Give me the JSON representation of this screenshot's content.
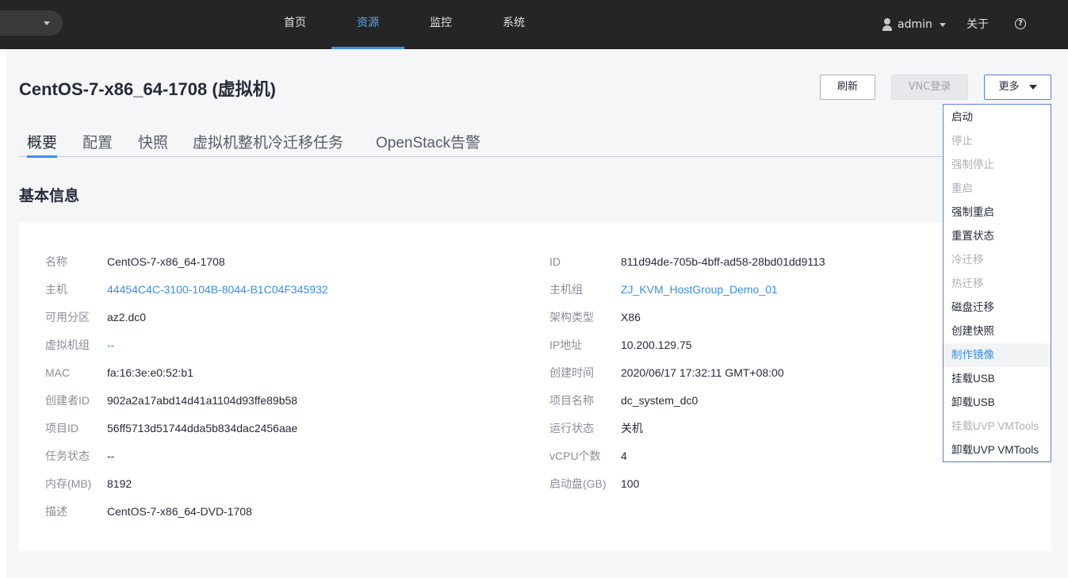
{
  "nav": {
    "items": [
      {
        "label": "首页"
      },
      {
        "label": "资源"
      },
      {
        "label": "监控"
      },
      {
        "label": "系统"
      }
    ],
    "active_index": 1,
    "user": "admin",
    "about": "关于",
    "help_glyph": "?"
  },
  "page": {
    "title": "CentOS-7-x86_64-1708 (虚拟机)",
    "buttons": {
      "refresh": "刷新",
      "vnc": "VNC登录",
      "more": "更多"
    }
  },
  "tabs": [
    {
      "label": "概要"
    },
    {
      "label": "配置"
    },
    {
      "label": "快照"
    },
    {
      "label": "虚拟机整机冷迁移任务"
    },
    {
      "label": "OpenStack告警"
    }
  ],
  "section_title": "基本信息",
  "info_left": [
    {
      "key": "名称",
      "value": "CentOS-7-x86_64-1708",
      "link": false
    },
    {
      "key": "主机",
      "value": "44454C4C-3100-104B-8044-B1C04F345932",
      "link": true
    },
    {
      "key": "可用分区",
      "value": "az2.dc0",
      "link": false
    },
    {
      "key": "虚拟机组",
      "value": "--",
      "link": true
    },
    {
      "key": "MAC",
      "value": "fa:16:3e:e0:52:b1",
      "link": false
    },
    {
      "key": "创建者ID",
      "value": "902a2a17abd14d41a1104d93ffe89b58",
      "link": false
    },
    {
      "key": "项目ID",
      "value": "56ff5713d51744dda5b834dac2456aae",
      "link": false
    },
    {
      "key": "任务状态",
      "value": "--",
      "link": false
    },
    {
      "key": "内存(MB)",
      "value": "8192",
      "link": false
    },
    {
      "key": "描述",
      "value": "CentOS-7-x86_64-DVD-1708",
      "link": false
    }
  ],
  "info_right": [
    {
      "key": "ID",
      "value": "811d94de-705b-4bff-ad58-28bd01dd9113",
      "link": false
    },
    {
      "key": "主机组",
      "value": "ZJ_KVM_HostGroup_Demo_01",
      "link": true
    },
    {
      "key": "架构类型",
      "value": "X86",
      "link": false
    },
    {
      "key": "IP地址",
      "value": "10.200.129.75",
      "link": false
    },
    {
      "key": "创建时间",
      "value": "2020/06/17 17:32:11 GMT+08:00",
      "link": false
    },
    {
      "key": "项目名称",
      "value": "dc_system_dc0",
      "link": false
    },
    {
      "key": "运行状态",
      "value": "关机",
      "link": false
    },
    {
      "key": "vCPU个数",
      "value": "4",
      "link": false
    },
    {
      "key": "启动盘(GB)",
      "value": "100",
      "link": false
    }
  ],
  "more_menu": [
    {
      "label": "启动",
      "disabled": false
    },
    {
      "label": "停止",
      "disabled": true
    },
    {
      "label": "强制停止",
      "disabled": true
    },
    {
      "label": "重启",
      "disabled": true
    },
    {
      "label": "强制重启",
      "disabled": false
    },
    {
      "label": "重置状态",
      "disabled": false
    },
    {
      "label": "冷迁移",
      "disabled": true
    },
    {
      "label": "热迁移",
      "disabled": true
    },
    {
      "label": "磁盘迁移",
      "disabled": false
    },
    {
      "label": "创建快照",
      "disabled": false
    },
    {
      "label": "制作镜像",
      "disabled": false,
      "hover": true
    },
    {
      "label": "挂载USB",
      "disabled": false
    },
    {
      "label": "卸载USB",
      "disabled": false
    },
    {
      "label": "挂载UVP VMTools",
      "disabled": true
    },
    {
      "label": "卸载UVP VMTools",
      "disabled": false
    }
  ],
  "colors": {
    "topbar": "#252525",
    "accent": "#3a8ee6",
    "link": "#3a8ee6",
    "dropdown_border": "#5e7ce0"
  }
}
